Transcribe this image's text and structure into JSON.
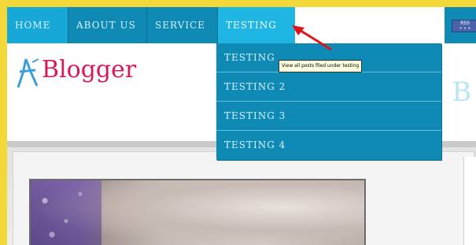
{
  "nav": {
    "items": [
      {
        "label": "HOME"
      },
      {
        "label": "ABOUT US"
      },
      {
        "label": "SERVICE"
      },
      {
        "label": "TESTING"
      }
    ]
  },
  "dropdown": {
    "items": [
      {
        "label": "TESTING"
      },
      {
        "label": "TESTING 2"
      },
      {
        "label": "TESTING 3"
      },
      {
        "label": "TESTING 4"
      }
    ],
    "tooltip": "View all posts filed under testing"
  },
  "header": {
    "logo_text": "Blogger",
    "faded_title": "o B"
  },
  "colors": {
    "nav_bg": "#0e8ab5",
    "nav_active": "#1fb6e3",
    "logo": "#d8185a",
    "arrow": "#e0141c",
    "page_border": "#f3d83a"
  },
  "icons": {
    "logo": "blogger-figure-icon",
    "annotation_arrow": "red-arrow-icon",
    "rss": "rss-badge-icon"
  }
}
